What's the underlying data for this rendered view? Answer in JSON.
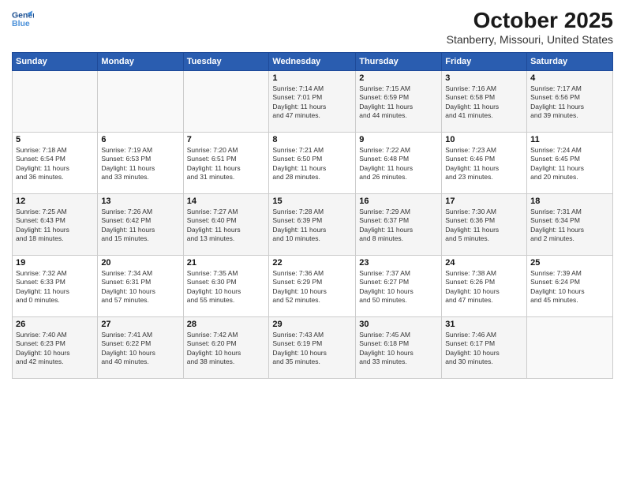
{
  "header": {
    "logo_line1": "General",
    "logo_line2": "Blue",
    "month": "October 2025",
    "location": "Stanberry, Missouri, United States"
  },
  "weekdays": [
    "Sunday",
    "Monday",
    "Tuesday",
    "Wednesday",
    "Thursday",
    "Friday",
    "Saturday"
  ],
  "weeks": [
    [
      {
        "day": "",
        "info": ""
      },
      {
        "day": "",
        "info": ""
      },
      {
        "day": "",
        "info": ""
      },
      {
        "day": "1",
        "info": "Sunrise: 7:14 AM\nSunset: 7:01 PM\nDaylight: 11 hours\nand 47 minutes."
      },
      {
        "day": "2",
        "info": "Sunrise: 7:15 AM\nSunset: 6:59 PM\nDaylight: 11 hours\nand 44 minutes."
      },
      {
        "day": "3",
        "info": "Sunrise: 7:16 AM\nSunset: 6:58 PM\nDaylight: 11 hours\nand 41 minutes."
      },
      {
        "day": "4",
        "info": "Sunrise: 7:17 AM\nSunset: 6:56 PM\nDaylight: 11 hours\nand 39 minutes."
      }
    ],
    [
      {
        "day": "5",
        "info": "Sunrise: 7:18 AM\nSunset: 6:54 PM\nDaylight: 11 hours\nand 36 minutes."
      },
      {
        "day": "6",
        "info": "Sunrise: 7:19 AM\nSunset: 6:53 PM\nDaylight: 11 hours\nand 33 minutes."
      },
      {
        "day": "7",
        "info": "Sunrise: 7:20 AM\nSunset: 6:51 PM\nDaylight: 11 hours\nand 31 minutes."
      },
      {
        "day": "8",
        "info": "Sunrise: 7:21 AM\nSunset: 6:50 PM\nDaylight: 11 hours\nand 28 minutes."
      },
      {
        "day": "9",
        "info": "Sunrise: 7:22 AM\nSunset: 6:48 PM\nDaylight: 11 hours\nand 26 minutes."
      },
      {
        "day": "10",
        "info": "Sunrise: 7:23 AM\nSunset: 6:46 PM\nDaylight: 11 hours\nand 23 minutes."
      },
      {
        "day": "11",
        "info": "Sunrise: 7:24 AM\nSunset: 6:45 PM\nDaylight: 11 hours\nand 20 minutes."
      }
    ],
    [
      {
        "day": "12",
        "info": "Sunrise: 7:25 AM\nSunset: 6:43 PM\nDaylight: 11 hours\nand 18 minutes."
      },
      {
        "day": "13",
        "info": "Sunrise: 7:26 AM\nSunset: 6:42 PM\nDaylight: 11 hours\nand 15 minutes."
      },
      {
        "day": "14",
        "info": "Sunrise: 7:27 AM\nSunset: 6:40 PM\nDaylight: 11 hours\nand 13 minutes."
      },
      {
        "day": "15",
        "info": "Sunrise: 7:28 AM\nSunset: 6:39 PM\nDaylight: 11 hours\nand 10 minutes."
      },
      {
        "day": "16",
        "info": "Sunrise: 7:29 AM\nSunset: 6:37 PM\nDaylight: 11 hours\nand 8 minutes."
      },
      {
        "day": "17",
        "info": "Sunrise: 7:30 AM\nSunset: 6:36 PM\nDaylight: 11 hours\nand 5 minutes."
      },
      {
        "day": "18",
        "info": "Sunrise: 7:31 AM\nSunset: 6:34 PM\nDaylight: 11 hours\nand 2 minutes."
      }
    ],
    [
      {
        "day": "19",
        "info": "Sunrise: 7:32 AM\nSunset: 6:33 PM\nDaylight: 11 hours\nand 0 minutes."
      },
      {
        "day": "20",
        "info": "Sunrise: 7:34 AM\nSunset: 6:31 PM\nDaylight: 10 hours\nand 57 minutes."
      },
      {
        "day": "21",
        "info": "Sunrise: 7:35 AM\nSunset: 6:30 PM\nDaylight: 10 hours\nand 55 minutes."
      },
      {
        "day": "22",
        "info": "Sunrise: 7:36 AM\nSunset: 6:29 PM\nDaylight: 10 hours\nand 52 minutes."
      },
      {
        "day": "23",
        "info": "Sunrise: 7:37 AM\nSunset: 6:27 PM\nDaylight: 10 hours\nand 50 minutes."
      },
      {
        "day": "24",
        "info": "Sunrise: 7:38 AM\nSunset: 6:26 PM\nDaylight: 10 hours\nand 47 minutes."
      },
      {
        "day": "25",
        "info": "Sunrise: 7:39 AM\nSunset: 6:24 PM\nDaylight: 10 hours\nand 45 minutes."
      }
    ],
    [
      {
        "day": "26",
        "info": "Sunrise: 7:40 AM\nSunset: 6:23 PM\nDaylight: 10 hours\nand 42 minutes."
      },
      {
        "day": "27",
        "info": "Sunrise: 7:41 AM\nSunset: 6:22 PM\nDaylight: 10 hours\nand 40 minutes."
      },
      {
        "day": "28",
        "info": "Sunrise: 7:42 AM\nSunset: 6:20 PM\nDaylight: 10 hours\nand 38 minutes."
      },
      {
        "day": "29",
        "info": "Sunrise: 7:43 AM\nSunset: 6:19 PM\nDaylight: 10 hours\nand 35 minutes."
      },
      {
        "day": "30",
        "info": "Sunrise: 7:45 AM\nSunset: 6:18 PM\nDaylight: 10 hours\nand 33 minutes."
      },
      {
        "day": "31",
        "info": "Sunrise: 7:46 AM\nSunset: 6:17 PM\nDaylight: 10 hours\nand 30 minutes."
      },
      {
        "day": "",
        "info": ""
      }
    ]
  ]
}
